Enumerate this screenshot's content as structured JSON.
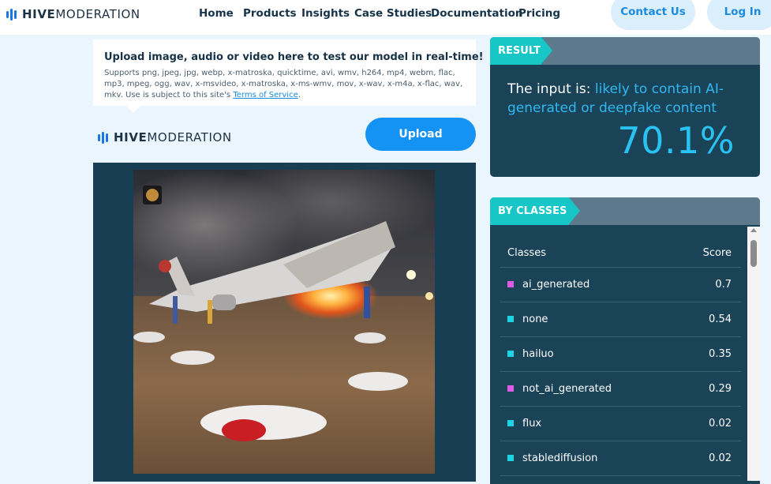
{
  "brand": {
    "name_bold": "HIVE",
    "name_rest": "MODERATION",
    "color": "#1976e8"
  },
  "nav": {
    "links": [
      "Home",
      "Products",
      "Insights",
      "Case Studies",
      "Documentation",
      "Pricing"
    ],
    "contact_label": "Contact Us",
    "login_label": "Log In"
  },
  "upload": {
    "title": "Upload image, audio or video here to test our model in real-time!",
    "supports_text": "Supports png, jpeg, jpg, webp, x-matroska, quicktime, avi, wmv, h264, mp4, webm, flac, mp3, mpeg, ogg, wav, x-msvideo, x-matroska, x-ms-wmv, mov, x-wav, x-m4a, x-flac, wav, mkv. Use is subject to this site's ",
    "terms_link": "Terms of Service",
    "terms_after": ".",
    "button_label": "Upload"
  },
  "preview": {
    "content": "plane-crash-photo"
  },
  "result": {
    "header": "RESULT",
    "prefix": "The input is: ",
    "verdict": "likely to contain AI-generated or deepfake content",
    "percent": "70.1%"
  },
  "classes": {
    "header": "BY CLASSES",
    "col_class": "Classes",
    "col_score": "Score",
    "rows": [
      {
        "name": "ai_generated",
        "score": "0.7",
        "color": "#e05ce6"
      },
      {
        "name": "none",
        "score": "0.54",
        "color": "#19d6e6"
      },
      {
        "name": "hailuo",
        "score": "0.35",
        "color": "#19d6e6"
      },
      {
        "name": "not_ai_generated",
        "score": "0.29",
        "color": "#e05ce6"
      },
      {
        "name": "flux",
        "score": "0.02",
        "color": "#19d6e6"
      },
      {
        "name": "stablediffusion",
        "score": "0.02",
        "color": "#19d6e6"
      }
    ]
  },
  "colors": {
    "accent": "#1593f5",
    "panel": "#1a4358",
    "tag": "#17c7c7",
    "percent": "#28c3f2"
  }
}
